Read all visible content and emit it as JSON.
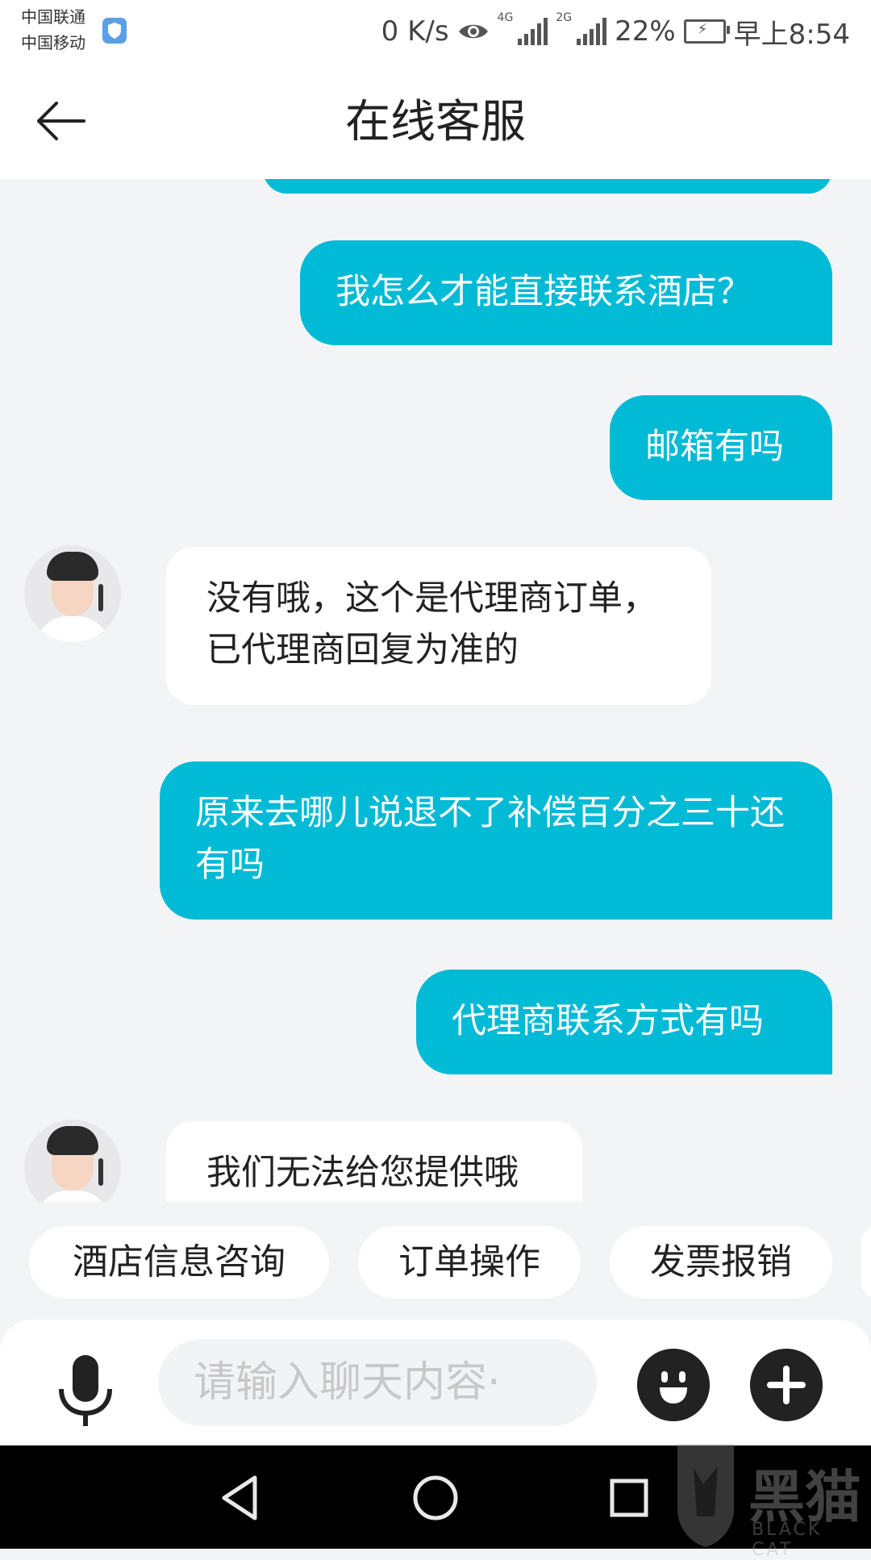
{
  "status_bar": {
    "carrier_1": "中国联通",
    "carrier_2": "中国移动",
    "net_speed": "0 K/s",
    "signal_1_label": "4G",
    "signal_2_label": "2G",
    "battery": "22%",
    "time": "早上8:54",
    "icons": [
      "shield-icon",
      "eye-icon",
      "signal-icon",
      "battery-icon"
    ]
  },
  "header": {
    "title": "在线客服",
    "back_icon": "arrow-left-icon"
  },
  "messages": [
    {
      "from": "me",
      "text": "我怎么才能直接联系酒店？"
    },
    {
      "from": "me",
      "text": "邮箱有吗"
    },
    {
      "from": "agent",
      "text": "没有哦，这个是代理商订单，已代理商回复为准的"
    },
    {
      "from": "me",
      "text": "原来去哪儿说退不了补偿百分之三十还有吗"
    },
    {
      "from": "me",
      "text": "代理商联系方式有吗"
    },
    {
      "from": "agent",
      "text": "我们无法给您提供哦"
    }
  ],
  "quick_replies": [
    "酒店信息咨询",
    "订单操作",
    "发票报销"
  ],
  "input": {
    "placeholder": "请输入聊天内容·",
    "icons": [
      "microphone-icon",
      "emoji-icon",
      "plus-icon"
    ]
  },
  "nav": {
    "icons": [
      "nav-back-icon",
      "nav-home-icon",
      "nav-recents-icon"
    ]
  },
  "watermark": {
    "text": "黑猫",
    "sub": "BLACK CAT"
  },
  "colors": {
    "accent": "#00bad6",
    "background": "#f3f4f6"
  }
}
